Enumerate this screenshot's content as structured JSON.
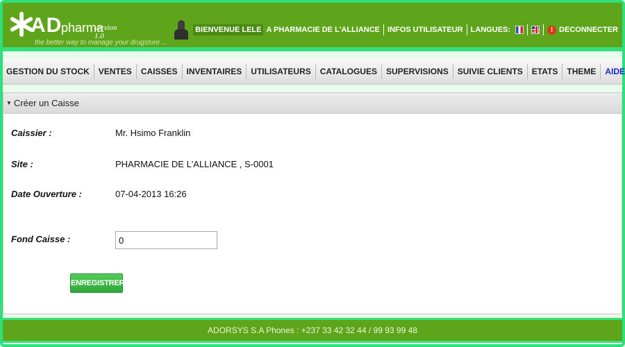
{
  "header": {
    "logo": {
      "ad": "AD",
      "pharma": "pharma",
      "version": "version 1.0",
      "tagline": "the better way to manage your drugstore ..."
    },
    "welcome": "BIENVENUE LELE",
    "pharmacy": "A PHARMACIE DE L'ALLIANCE",
    "user_info": "INFOS UTILISATEUR",
    "languages_label": "LANGUES:",
    "logout": "DECONNECTER"
  },
  "nav": {
    "items": [
      "GESTION DU STOCK",
      "VENTES",
      "CAISSES",
      "INVENTAIRES",
      "UTILISATEURS",
      "CATALOGUES",
      "SUPERVISIONS",
      "SUIVIE CLIENTS",
      "ETATS",
      "THEME",
      "AIDE"
    ]
  },
  "panel": {
    "title": "Créer un Caisse",
    "caissier_label": "Caissier :",
    "caissier_value": "Mr. Hsimo Franklin",
    "site_label": "Site :",
    "site_value": "PHARMACIE DE L'ALLIANCE , S-0001",
    "date_label": "Date Ouverture :",
    "date_value": "07-04-2013 16:26",
    "fond_label": "Fond Caisse :",
    "fond_value": "0",
    "save_label": "ENREGISTRER"
  },
  "footer": {
    "text": "ADORSYS S.A Phones : +237 33 42 32 44 / 99 93 99 48"
  },
  "colors": {
    "header_green": "#5fa51c",
    "frame_green": "#36e07e",
    "button_green": "#3db846",
    "aide_blue": "#1528c8"
  }
}
